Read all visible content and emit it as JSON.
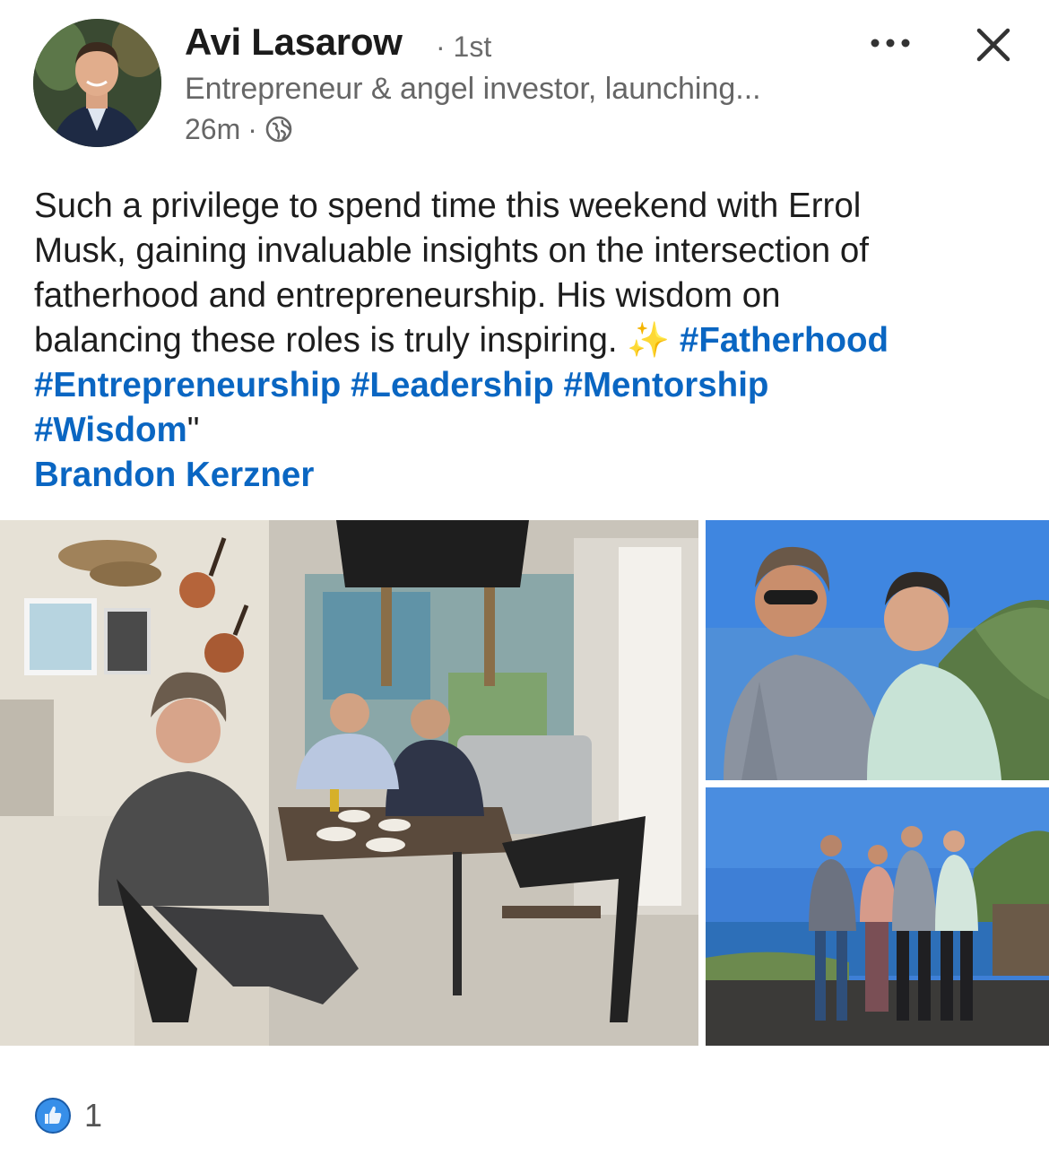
{
  "author": {
    "name": "Avi Lasarow",
    "degree": "· 1st",
    "headline": "Entrepreneur & angel investor, launching...",
    "time": "26m",
    "dot": "·",
    "visibility_icon": "globe-icon"
  },
  "header_actions": {
    "more_label": "•••",
    "close_label": "✕"
  },
  "post": {
    "line1": "Such a privilege to spend time this weekend with Errol",
    "line2": "Musk, gaining invaluable insights on the intersection of",
    "line3": "fatherhood and entrepreneurship. His wisdom on",
    "line4_text": "balancing these roles is truly inspiring.",
    "line4_emoji": "✨",
    "hashtag_fatherhood": "#Fatherhood",
    "hashtag_entrepreneurship": "#Entrepreneurship",
    "hashtag_leadership": "#Leadership",
    "hashtag_mentorship": "#Mentorship",
    "hashtag_wisdom": "#Wisdom",
    "trailing_quote": "\"",
    "mention": "Brandon Kerzner"
  },
  "reactions": {
    "icon": "like-icon",
    "count": "1"
  },
  "colors": {
    "link": "#0a66c2",
    "text": "#1d1d1d",
    "muted": "#666666"
  }
}
